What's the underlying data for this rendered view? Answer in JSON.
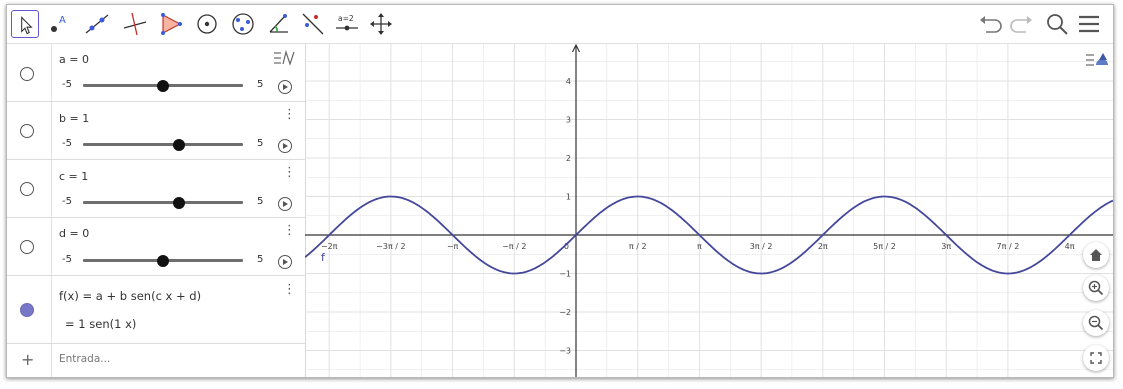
{
  "toolbar": {
    "tools": [
      "move-tool-icon",
      "point-tool-icon",
      "line-tool-icon",
      "perpendicular-tool-icon",
      "polygon-tool-icon",
      "circle-tool-icon",
      "conic-tool-icon",
      "angle-tool-icon",
      "reflect-tool-icon",
      "slider-tool-icon",
      "move-view-tool-icon"
    ],
    "slider_tool_text": "a=2",
    "point_tool_text": "A",
    "right": [
      "undo-icon",
      "redo-icon",
      "search-icon",
      "menu-icon"
    ]
  },
  "algebra": {
    "sliders": [
      {
        "definition": "a = 0",
        "min": "-5",
        "max": "5",
        "value": 0
      },
      {
        "definition": "b = 1",
        "min": "-5",
        "max": "5",
        "value": 1
      },
      {
        "definition": "c = 1",
        "min": "-5",
        "max": "5",
        "value": 1
      },
      {
        "definition": "d = 0",
        "min": "-5",
        "max": "5",
        "value": 0
      }
    ],
    "function": {
      "definition": "f(x) = a + b sen(c x + d)",
      "value": "= 1 sen(1 x)"
    },
    "input_placeholder": "Entrada...",
    "add_symbol": "+"
  },
  "graphics": {
    "function_label": "f",
    "x_ticks": [
      "−2π",
      "−3π / 2",
      "−π",
      "−π / 2",
      "0",
      "π / 2",
      "π",
      "3π / 2",
      "2π",
      "5π / 2",
      "3π",
      "7π / 2",
      "4π"
    ],
    "y_ticks": [
      "4",
      "3",
      "2",
      "1",
      "−1",
      "−2",
      "−3"
    ],
    "colors": {
      "curve": "#44489a",
      "grid": "#e1e1e1",
      "axis": "#333333"
    },
    "side_buttons": [
      "home-icon",
      "zoom-in-icon",
      "zoom-out-icon",
      "fullscreen-icon"
    ]
  }
}
